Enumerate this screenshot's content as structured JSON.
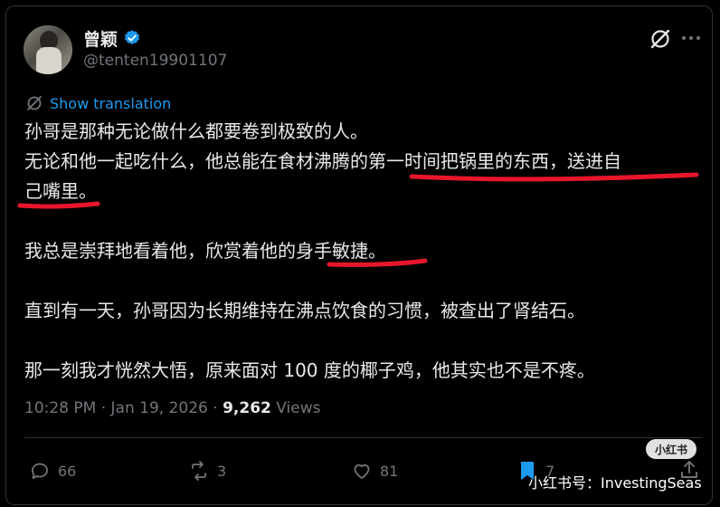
{
  "author": {
    "name": "曾颖",
    "handle": "@tenten19901107"
  },
  "translate": {
    "label": "Show translation"
  },
  "tweet": {
    "lines": [
      "孙哥是那种无论做什么都要卷到极致的人。",
      "无论和他一起吃什么，他总能在食材沸腾的第一时间把锅里的东西，送进自",
      "己嘴里。",
      "我总是崇拜地看着他，欣赏着他的身手敏捷。",
      "直到有一天，孙哥因为长期维持在沸点饮食的习惯，被查出了肾结石。",
      "那一刻我才恍然大悟，原来面对 100 度的椰子鸡，他其实也不是不疼。"
    ]
  },
  "meta": {
    "time": "10:28 PM",
    "sep": "·",
    "date": "Jan 19, 2026",
    "views_count": "9,262",
    "views_label": "Views"
  },
  "actions": {
    "replies": "66",
    "reposts": "3",
    "likes": "81",
    "bookmarks": "7"
  },
  "watermark": {
    "badge": "小红书",
    "text": "小红书号：InvestingSeas"
  },
  "colors": {
    "background": "#000000",
    "text": "#e7e9ea",
    "muted": "#71767b",
    "link": "#1d9bf0",
    "verified": "#1d9bf0",
    "annotation": "#e8162b"
  },
  "icons": [
    "verified-badge-icon",
    "grok-icon",
    "more-icon",
    "translate-icon",
    "reply-icon",
    "repost-icon",
    "like-icon",
    "bookmark-icon",
    "share-icon"
  ]
}
